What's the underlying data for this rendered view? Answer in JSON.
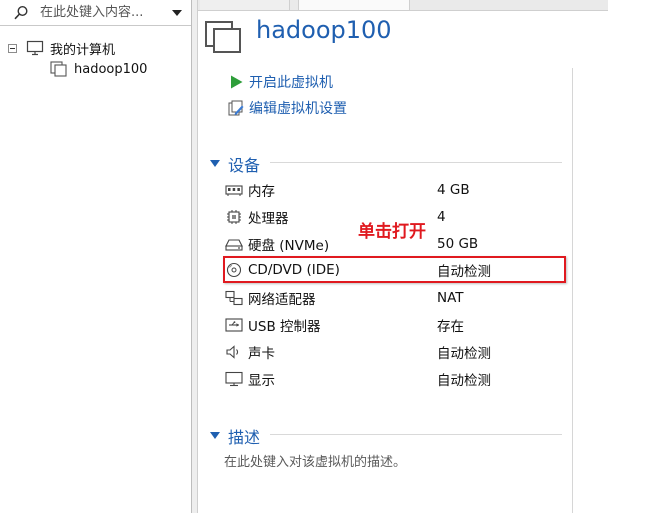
{
  "library": {
    "search_placeholder": "在此处键入内容...",
    "tree": {
      "root_label": "我的计算机",
      "child_label": "hadoop100"
    }
  },
  "vm": {
    "title": "hadoop100",
    "actions": {
      "power_on": "开启此虚拟机",
      "edit_settings": "编辑虚拟机设置"
    }
  },
  "devices": {
    "section_title": "设备",
    "items": [
      {
        "icon": "memory-icon",
        "name": "内存",
        "value": "4 GB"
      },
      {
        "icon": "processor-icon",
        "name": "处理器",
        "value": "4"
      },
      {
        "icon": "hard-disk-icon",
        "name": "硬盘 (NVMe)",
        "value": "50 GB"
      },
      {
        "icon": "cd-dvd-icon",
        "name": "CD/DVD (IDE)",
        "value": "自动检测"
      },
      {
        "icon": "network-adapter-icon",
        "name": "网络适配器",
        "value": "NAT"
      },
      {
        "icon": "usb-icon",
        "name": "USB 控制器",
        "value": "存在"
      },
      {
        "icon": "sound-card-icon",
        "name": "声卡",
        "value": "自动检测"
      },
      {
        "icon": "display-icon",
        "name": "显示",
        "value": "自动检测"
      }
    ]
  },
  "annotation": {
    "text": "单击打开",
    "color": "#e0191f"
  },
  "description": {
    "section_title": "描述",
    "placeholder": "在此处键入对该虚拟机的描述。"
  },
  "colors": {
    "accent": "#1f5fb0",
    "play_green": "#2e9e3a",
    "highlight_red": "#e0191f"
  }
}
